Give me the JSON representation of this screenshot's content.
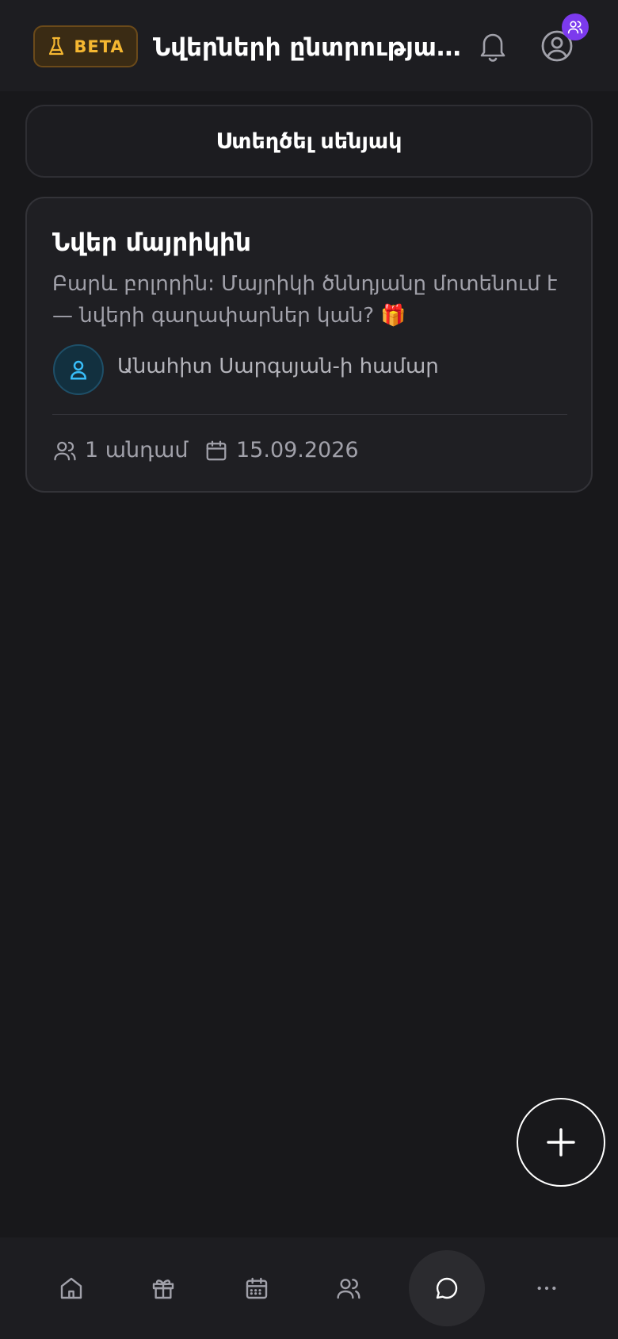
{
  "header": {
    "beta_label": "BETA",
    "title": "Նվերների ընտրության սենյակներ",
    "icons": [
      "flask-icon",
      "bell-icon",
      "user-circle-icon",
      "users-icon"
    ]
  },
  "create_button": {
    "label": "Ստեղծել սենյակ"
  },
  "room": {
    "title": "Նվեր մայրիկին",
    "description": "Բարև բոլորին: Մայրիկի ծննդյանը մոտենում է — նվերի գաղափարներ կան? 🎁",
    "recipient": "Անահիտ Սարգսյան-ի համար",
    "members": "1 անդամ",
    "date": "15.09.2026"
  },
  "bottom_nav": {
    "items": [
      "home-icon",
      "gift-icon",
      "calendar-icon",
      "users-icon",
      "chat-icon",
      "more-icon"
    ],
    "active": "chat-icon"
  },
  "colors": {
    "background": "#18181b",
    "beta_accent": "#f5b731",
    "badge": "#7c3aed",
    "recipient_icon": "#38bdf8"
  }
}
